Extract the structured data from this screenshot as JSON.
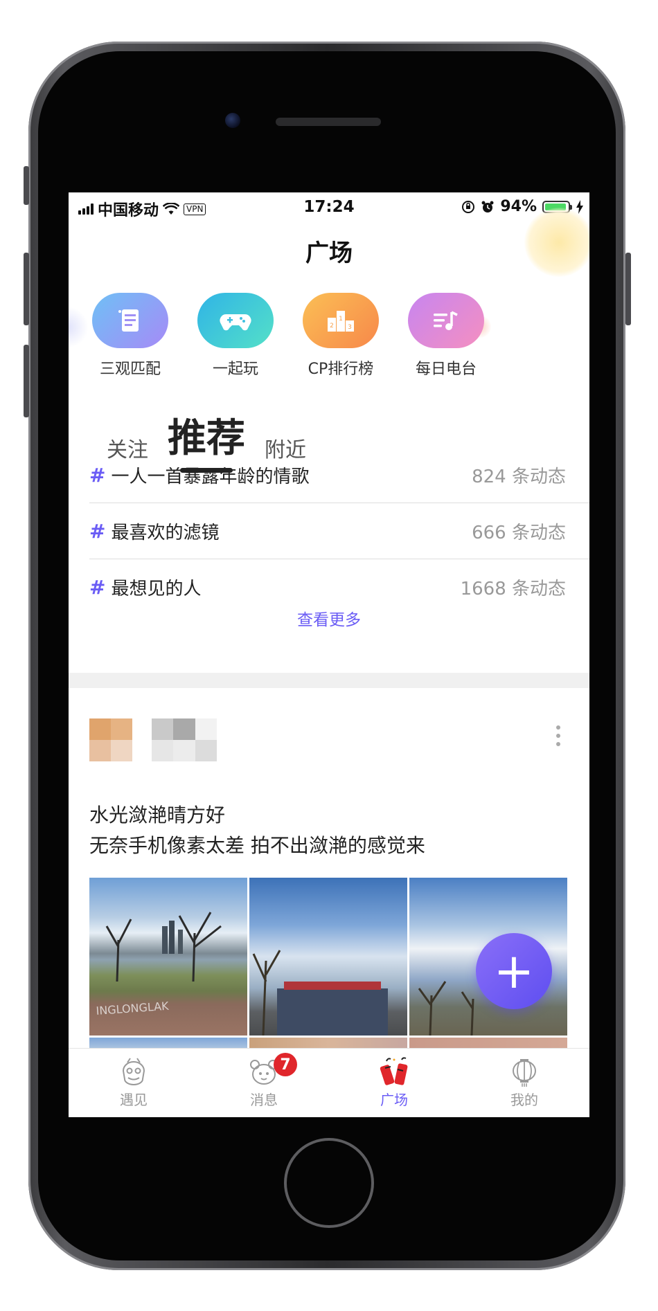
{
  "status_bar": {
    "carrier": "中国移动",
    "vpn": "VPN",
    "time": "17:24",
    "battery": "94%",
    "battery_level": 0.94
  },
  "page_title": "广场",
  "quick_actions": [
    {
      "label": "三观匹配",
      "icon": "checklist-icon",
      "color": "#8f8ff7"
    },
    {
      "label": "一起玩",
      "icon": "gamepad-icon",
      "color": "#3fc6e0"
    },
    {
      "label": "CP排行榜",
      "icon": "podium-icon",
      "color": "#f7a04a"
    },
    {
      "label": "每日电台",
      "icon": "music-list-icon",
      "color": "#e88ad6"
    }
  ],
  "feed_tabs": [
    {
      "label": "关注",
      "active": false
    },
    {
      "label": "推荐",
      "active": true
    },
    {
      "label": "附近",
      "active": false
    }
  ],
  "topics": [
    {
      "hash": "#",
      "name": "一人一首暴露年龄的情歌",
      "count": "824 条动态"
    },
    {
      "hash": "#",
      "name": "最喜欢的滤镜",
      "count": "666 条动态"
    },
    {
      "hash": "#",
      "name": "最想见的人",
      "count": "1668 条动态"
    }
  ],
  "see_more": "查看更多",
  "post": {
    "line1": "水光潋滟晴方好",
    "line2": "无奈手机像素太差 拍不出潋滟的感觉来",
    "photo_count_visible": 6
  },
  "fab_label": "+",
  "tab_bar": [
    {
      "label": "遇见",
      "icon": "lion-dance-icon",
      "active": false
    },
    {
      "label": "消息",
      "icon": "mouse-face-icon",
      "active": false,
      "badge": "7"
    },
    {
      "label": "广场",
      "icon": "firecracker-icon",
      "active": true
    },
    {
      "label": "我的",
      "icon": "lantern-icon",
      "active": false
    }
  ],
  "colors": {
    "accent": "#6a5cf5",
    "badge": "#e0262b"
  }
}
